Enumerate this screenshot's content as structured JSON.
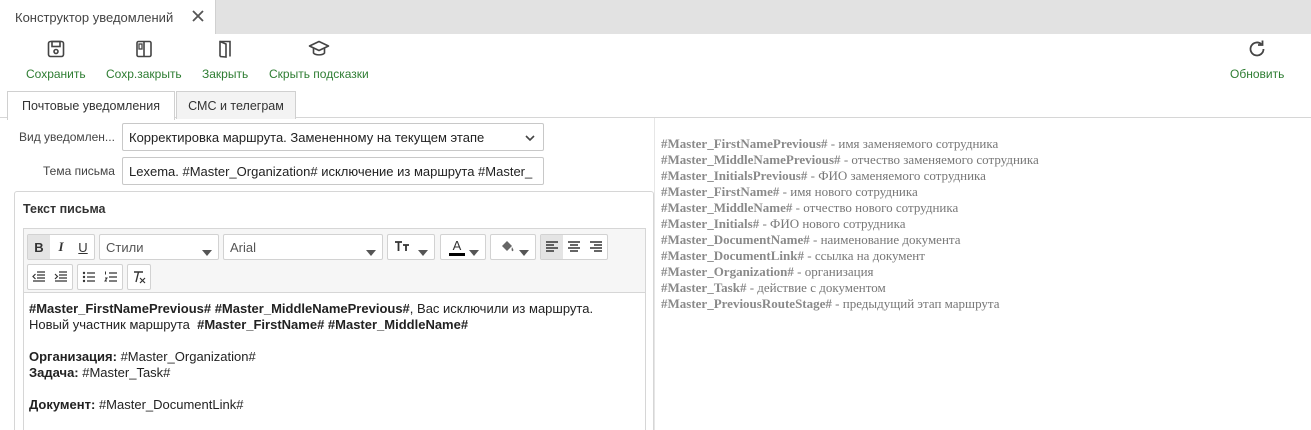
{
  "document_tab": {
    "title": "Конструктор уведомлений"
  },
  "toolbar": {
    "save_label": "Сохранить",
    "save_close_label": "Сохр.закрыть",
    "close_label": "Закрыть",
    "hide_hints_label": "Скрыть подсказки",
    "refresh_label": "Обновить",
    "accent_color": "#2e7d32"
  },
  "tabs": [
    {
      "label": "Почтовые уведомления",
      "active": true
    },
    {
      "label": "СМС и телеграм",
      "active": false
    }
  ],
  "form": {
    "notification_type_label": "Вид уведомлен...",
    "notification_type_value": "Корректировка маршрута. Замененному на текущем этапе",
    "subject_label": "Тема письма",
    "subject_value": "Lexema. #Master_Organization# исключение из маршрута #Master_"
  },
  "letter": {
    "title": "Текст письма",
    "toolbar": {
      "bold": "B",
      "italic": "I",
      "underline": "U",
      "styles_placeholder": "Стили",
      "font_value": "Arial",
      "text_size_icon": "text-size-icon",
      "font_color_label": "A",
      "bg_color_icon": "paint-bucket-icon"
    },
    "content": {
      "line1_bold": "#Master_FirstNamePrevious# #Master_MiddleNamePrevious#",
      "line1_rest": ", Вас исключили из маршрута.",
      "line2_plain": "Новый участник маршрута  ",
      "line2_bold": "#Master_FirstName# #Master_MiddleName#",
      "org_label": "Организация:",
      "org_value": " #Master_Organization#",
      "task_label": "Задача:",
      "task_value": " #Master_Task#",
      "doc_label": "Документ:",
      "doc_value": " #Master_DocumentLink#"
    }
  },
  "hints": [
    {
      "tag": "#Master_FirstNamePrevious#",
      "text": " - имя заменяемого сотрудника"
    },
    {
      "tag": "#Master_MiddleNamePrevious#",
      "text": " - отчество заменяемого сотрудника"
    },
    {
      "tag": "#Master_InitialsPrevious#",
      "text": " - ФИО заменяемого сотрудника"
    },
    {
      "tag": "#Master_FirstName#",
      "text": " - имя нового сотрудника"
    },
    {
      "tag": "#Master_MiddleName#",
      "text": " - отчество нового сотрудника"
    },
    {
      "tag": "#Master_Initials#",
      "text": " - ФИО нового сотрудника"
    },
    {
      "tag": "#Master_DocumentName#",
      "text": " - наименование документа"
    },
    {
      "tag": "#Master_DocumentLink#",
      "text": " - ссылка на документ"
    },
    {
      "tag": "#Master_Organization#",
      "text": " - организация"
    },
    {
      "tag": "#Master_Task#",
      "text": " - действие с документом"
    },
    {
      "tag": "#Master_PreviousRouteStage#",
      "text": " - предыдущий этап маршрута"
    }
  ]
}
